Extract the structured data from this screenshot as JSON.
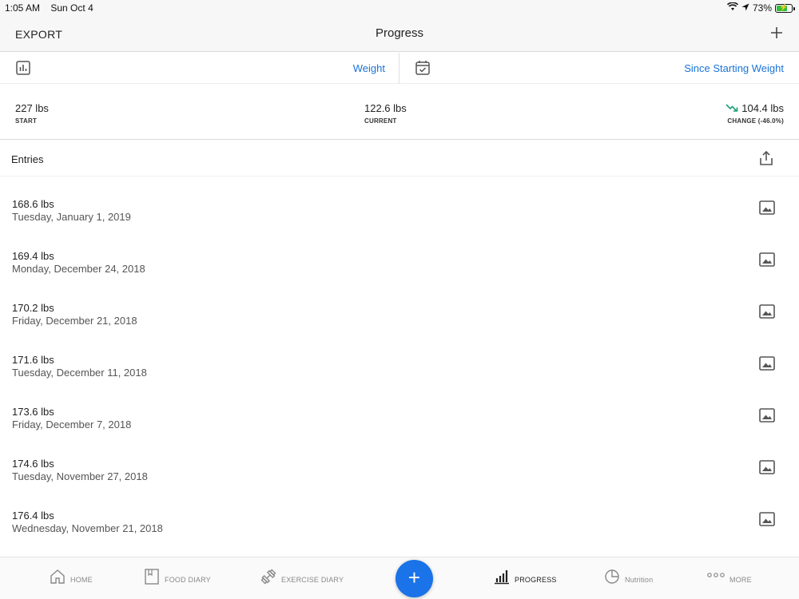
{
  "status_bar": {
    "time": "1:05 AM",
    "date": "Sun Oct 4",
    "battery_pct": "73%",
    "battery_level": 0.73
  },
  "nav": {
    "export_label": "EXPORT",
    "title": "Progress",
    "add_icon": "plus-icon"
  },
  "filters": {
    "metric": "Weight",
    "range": "Since Starting Weight"
  },
  "summary": {
    "start": {
      "value": "227 lbs",
      "label": "START"
    },
    "current": {
      "value": "122.6 lbs",
      "label": "CURRENT"
    },
    "change": {
      "value": "104.4 lbs",
      "label": "CHANGE (-46.0%)",
      "trend_color": "#1b9e77"
    }
  },
  "entries": {
    "heading": "Entries",
    "items": [
      {
        "weight": "168.6 lbs",
        "date": "Tuesday, January 1, 2019"
      },
      {
        "weight": "169.4 lbs",
        "date": "Monday, December 24, 2018"
      },
      {
        "weight": "170.2 lbs",
        "date": "Friday, December 21, 2018"
      },
      {
        "weight": "171.6 lbs",
        "date": "Tuesday, December 11, 2018"
      },
      {
        "weight": "173.6 lbs",
        "date": "Friday, December 7, 2018"
      },
      {
        "weight": "174.6 lbs",
        "date": "Tuesday, November 27, 2018"
      },
      {
        "weight": "176.4 lbs",
        "date": "Wednesday, November 21, 2018"
      }
    ]
  },
  "tabs": [
    {
      "label": "HOME",
      "icon": "home-icon"
    },
    {
      "label": "FOOD DIARY",
      "icon": "book-icon"
    },
    {
      "label": "EXERCISE DIARY",
      "icon": "dumbbell-icon"
    },
    {
      "label": "PROGRESS",
      "icon": "bar-chart-icon",
      "active": true
    },
    {
      "label": "Nutrition",
      "icon": "pie-chart-icon"
    },
    {
      "label": "MORE",
      "icon": "more-dots-icon"
    }
  ],
  "colors": {
    "accent": "#1a73e8",
    "link": "#1a73d9"
  }
}
